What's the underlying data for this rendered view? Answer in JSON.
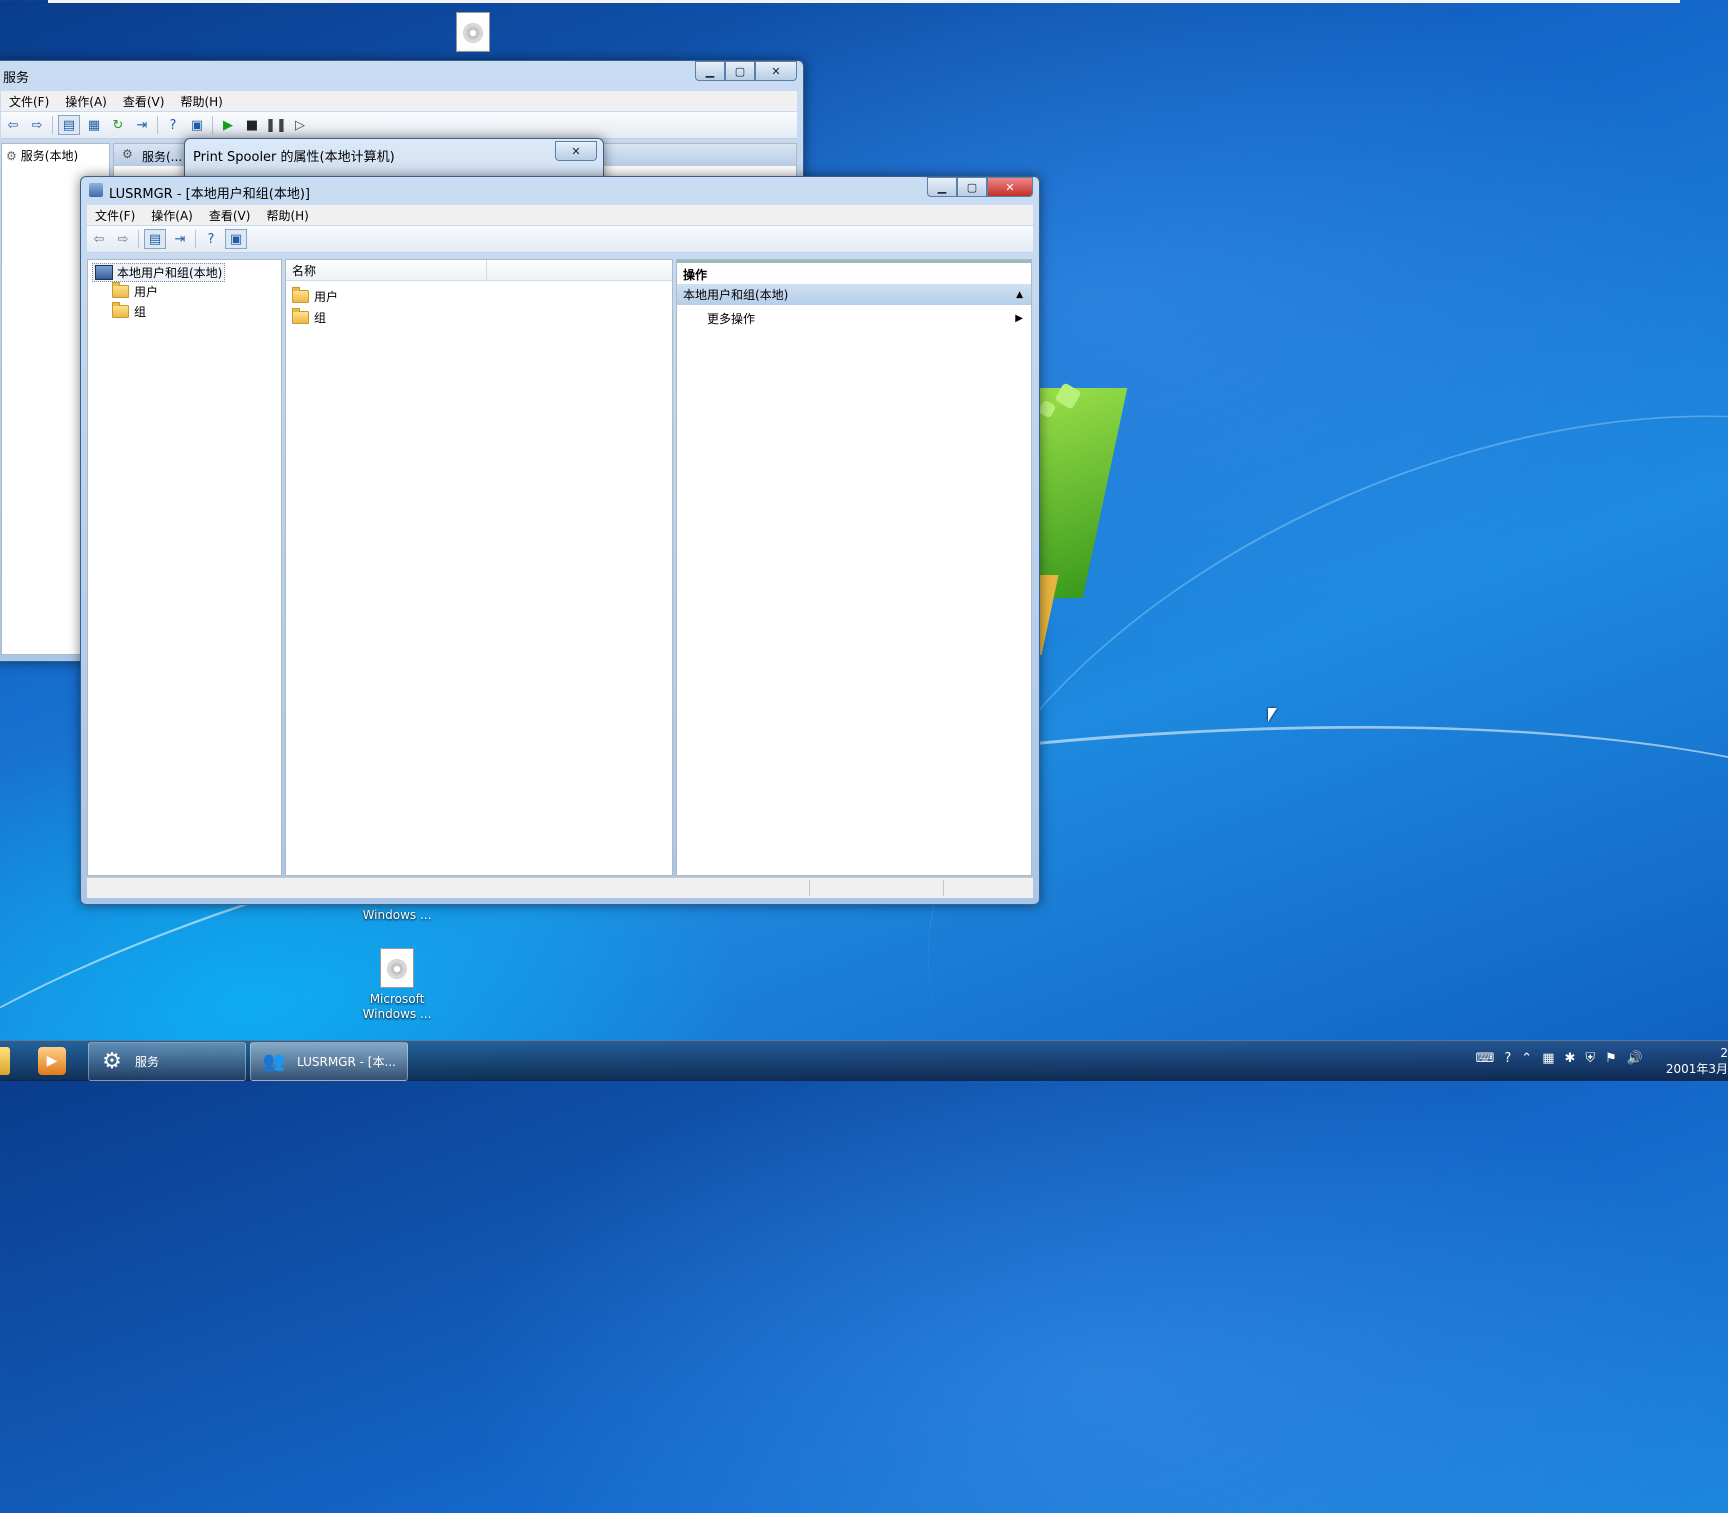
{
  "desktop": {
    "icons": [
      {
        "label_line1": "Windows ...",
        "label_line2": ""
      },
      {
        "label_line1": "Microsoft",
        "label_line2": "Windows ..."
      }
    ]
  },
  "services_window": {
    "title": "服务",
    "menu": [
      "文件(F)",
      "操作(A)",
      "查看(V)",
      "帮助(H)"
    ],
    "tree_root": "服务(本地)",
    "header_tab": "服务(..."
  },
  "spooler_dialog": {
    "title": "Print Spooler 的属性(本地计算机)",
    "close_label": "✕"
  },
  "lusrmgr": {
    "title": "LUSRMGR - [本地用户和组(本地)]",
    "menu": [
      "文件(F)",
      "操作(A)",
      "查看(V)",
      "帮助(H)"
    ],
    "tree": {
      "root": "本地用户和组(本地)",
      "children": [
        "用户",
        "组"
      ]
    },
    "list": {
      "column_name": "名称",
      "items": [
        "用户",
        "组"
      ]
    },
    "actions": {
      "title": "操作",
      "group": "本地用户和组(本地)",
      "more": "更多操作"
    }
  },
  "taskbar": {
    "buttons": [
      {
        "label": "服务"
      },
      {
        "label": "LUSRMGR - [本..."
      }
    ],
    "clock_time": "2",
    "clock_date": "2001年3月"
  }
}
